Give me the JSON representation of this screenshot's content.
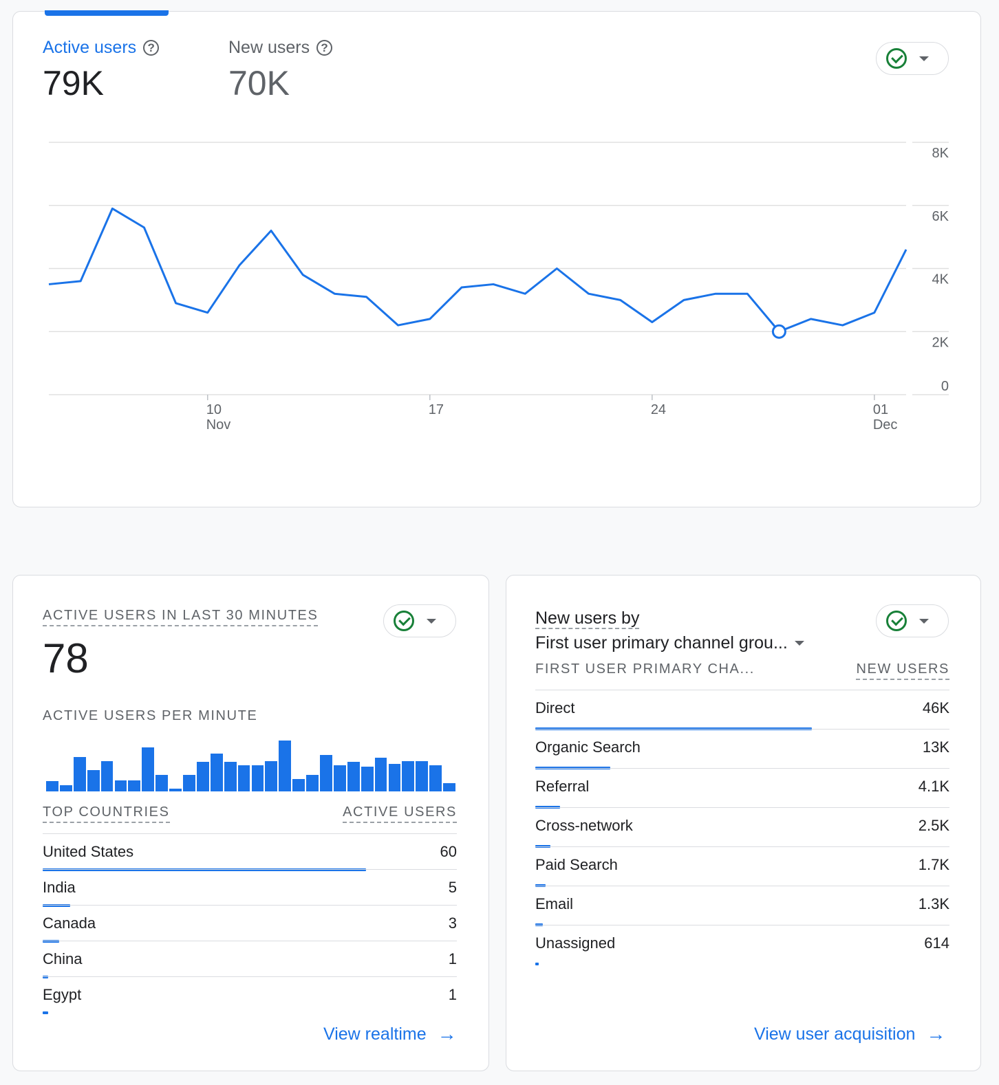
{
  "overview": {
    "metrics": [
      {
        "label": "Active users",
        "value": "79K"
      },
      {
        "label": "New users",
        "value": "70K"
      }
    ]
  },
  "chart_data": {
    "type": "line",
    "series": [
      {
        "values": [
          3.5,
          3.6,
          5.9,
          5.3,
          2.9,
          2.6,
          4.1,
          5.2,
          3.8,
          3.2,
          3.1,
          2.2,
          2.4,
          3.4,
          3.5,
          3.2,
          4.0,
          3.2,
          3.0,
          2.3,
          3.0,
          3.2,
          3.2,
          2.0,
          2.4,
          2.2,
          2.6,
          4.6
        ]
      }
    ],
    "highlight_index": 23,
    "x_ticks": [
      {
        "day": "10",
        "month": "Nov",
        "index": 5
      },
      {
        "day": "17",
        "month": "",
        "index": 12
      },
      {
        "day": "24",
        "month": "",
        "index": 19
      },
      {
        "day": "01",
        "month": "Dec",
        "index": 26
      }
    ],
    "y_ticks": [
      "0",
      "2K",
      "4K",
      "6K",
      "8K"
    ],
    "ylim": [
      0,
      8
    ],
    "grid": true,
    "color": "#1a73e8"
  },
  "realtime": {
    "title": "ACTIVE USERS IN LAST 30 MINUTES",
    "count": "78",
    "per_minute_label": "ACTIVE USERS PER MINUTE",
    "per_minute": [
      1,
      0.6,
      3.4,
      2.1,
      3.0,
      1.1,
      1.1,
      4.3,
      1.6,
      0.3,
      1.6,
      2.9,
      3.7,
      2.9,
      2.6,
      2.6,
      3.0,
      5.0,
      1.2,
      1.6,
      3.6,
      2.6,
      2.9,
      2.4,
      3.3,
      2.7,
      3.0,
      3.0,
      2.6,
      0.8
    ],
    "table_headers": [
      "TOP COUNTRIES",
      "ACTIVE USERS"
    ],
    "rows": [
      {
        "label": "United States",
        "value": "60",
        "share": 1.0
      },
      {
        "label": "India",
        "value": "5",
        "share": 0.085
      },
      {
        "label": "Canada",
        "value": "3",
        "share": 0.05
      },
      {
        "label": "China",
        "value": "1",
        "share": 0.017
      },
      {
        "label": "Egypt",
        "value": "1",
        "share": 0.017
      }
    ],
    "link": "View realtime"
  },
  "acquisition": {
    "title_line1": "New users by",
    "dimension": "First user primary channel grou...",
    "table_headers": [
      "FIRST USER PRIMARY CHA...",
      "NEW USERS"
    ],
    "rows": [
      {
        "label": "Direct",
        "value": "46K",
        "share": 1.0
      },
      {
        "label": "Organic Search",
        "value": "13K",
        "share": 0.27
      },
      {
        "label": "Referral",
        "value": "4.1K",
        "share": 0.09
      },
      {
        "label": "Cross-network",
        "value": "2.5K",
        "share": 0.055
      },
      {
        "label": "Paid Search",
        "value": "1.7K",
        "share": 0.037
      },
      {
        "label": "Email",
        "value": "1.3K",
        "share": 0.028
      },
      {
        "label": "Unassigned",
        "value": "614",
        "share": 0.013
      }
    ],
    "link": "View user acquisition"
  }
}
